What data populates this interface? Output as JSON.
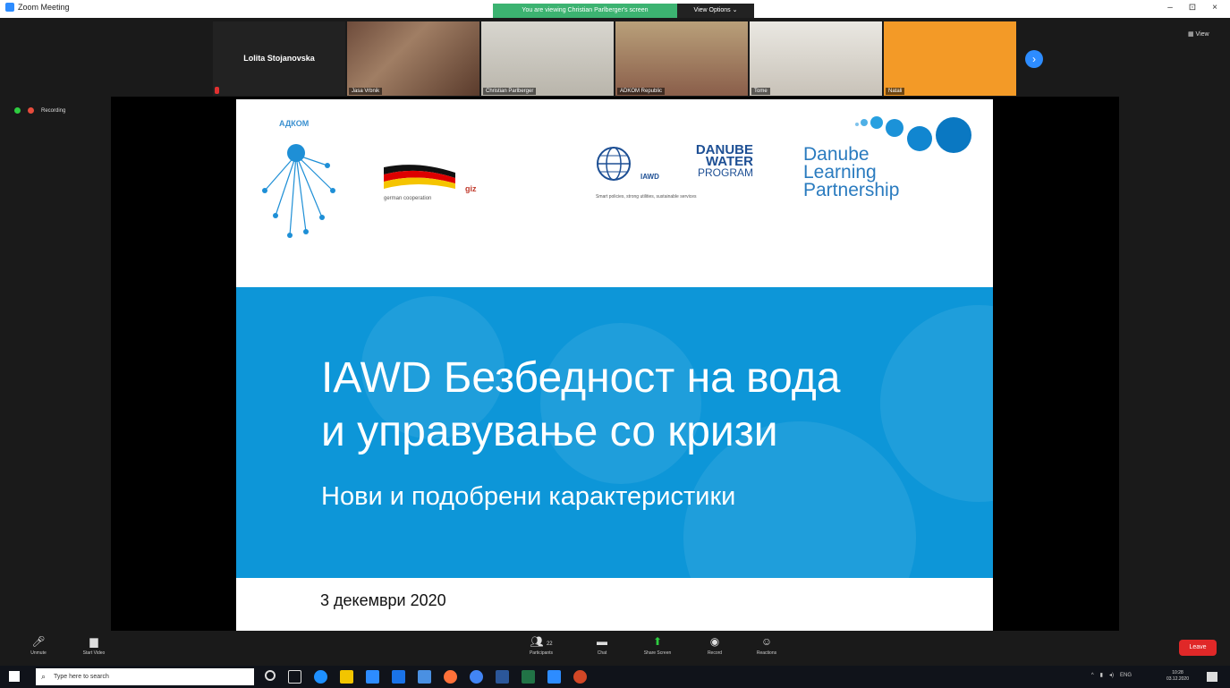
{
  "window": {
    "title": "Zoom Meeting",
    "minimize": "–",
    "maximize": "⊡",
    "close": "×"
  },
  "share_banner": "You are viewing Christian Parlberger's screen",
  "view_options": "View Options ⌄",
  "view_button": "▦ View",
  "recording": "Recording",
  "participants": [
    {
      "name": "Lolita Stojanovska"
    },
    {
      "name": "Jasa Vrbnik"
    },
    {
      "name": "Christian Parlberger"
    },
    {
      "name": "ADKOM Republic"
    },
    {
      "name": "Tome"
    },
    {
      "name": "Natali"
    }
  ],
  "slide": {
    "adkom_label": "АДКОМ",
    "german_cooperation": "german cooperation",
    "giz": "giz",
    "dwp_title_1": "DANUBE",
    "dwp_title_2": "WATER",
    "dwp_title_3": "PROGRAM",
    "dwp_iawd": "IAWD",
    "dwp_tagline": "Smart policies, strong utilities, sustainable services",
    "dlp_1": "Danube",
    "dlp_2": "Learning",
    "dlp_3": "Partnership",
    "title_line1": "IAWD Безбедност на вода",
    "title_line2": "и управување со кризи",
    "subtitle": "Нови и подобрени карактеристики",
    "date": "3 декември 2020"
  },
  "toolbar": {
    "unmute": "Unmute",
    "start_video": "Start Video",
    "participants": "Participants",
    "participants_count": "22",
    "chat": "Chat",
    "share_screen": "Share Screen",
    "record": "Record",
    "reactions": "Reactions",
    "leave": "Leave"
  },
  "taskbar": {
    "search_placeholder": "Type here to search",
    "lang": "ENG",
    "time": "10:28",
    "date": "03.12.2020"
  },
  "colors": {
    "zoom_blue": "#2d8cff",
    "leave_red": "#e02828",
    "slide_blue": "#0d96d8",
    "share_green": "#3cb371"
  }
}
